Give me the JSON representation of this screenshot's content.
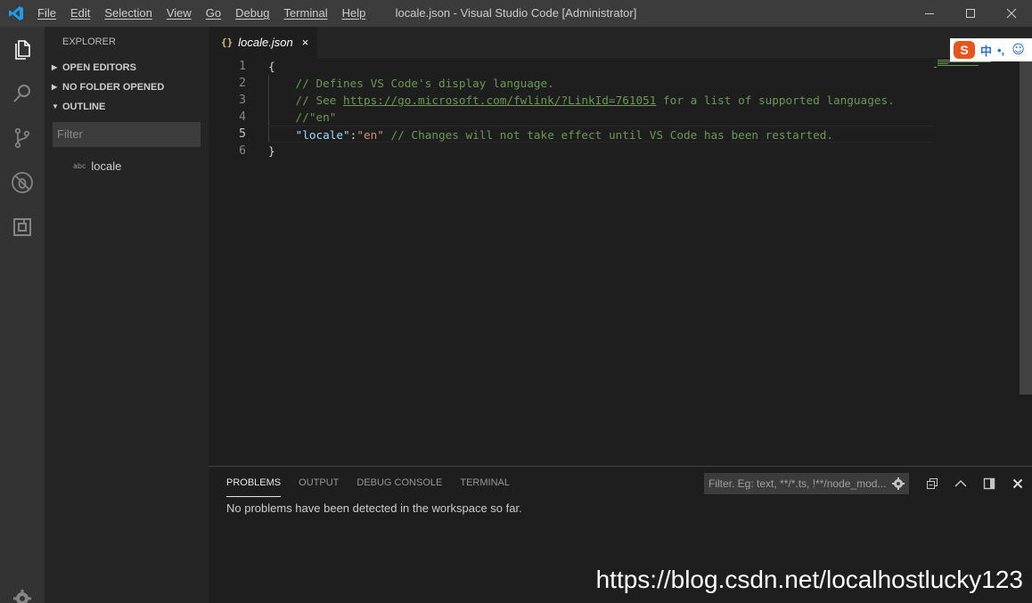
{
  "titlebar": {
    "menu": [
      "File",
      "Edit",
      "Selection",
      "View",
      "Go",
      "Debug",
      "Terminal",
      "Help"
    ],
    "title": "locale.json - Visual Studio Code [Administrator]",
    "icons": [
      "vscode-logo-icon",
      "minimize-icon",
      "maximize-icon",
      "close-icon"
    ]
  },
  "activitybar": {
    "icons": [
      "files-icon",
      "search-icon",
      "source-control-icon",
      "debug-icon",
      "extensions-icon",
      "gear-icon"
    ]
  },
  "sidebar": {
    "title": "EXPLORER",
    "sections": [
      "OPEN EDITORS",
      "NO FOLDER OPENED",
      "OUTLINE"
    ],
    "filter_placeholder": "Filter",
    "outline_item": "locale",
    "outline_item_badge": "abc"
  },
  "tab": {
    "icon": "{}",
    "label": "locale.json",
    "close": "×"
  },
  "editor": {
    "line_numbers": [
      "1",
      "2",
      "3",
      "4",
      "5",
      "6"
    ],
    "active_line": 5,
    "lines": {
      "l1": "{",
      "l2": "    // Defines VS Code's display language.",
      "l3_pre": "    // See ",
      "l3_link": "https://go.microsoft.com/fwlink/?LinkId=761051",
      "l3_post": " for a list of supported languages.",
      "l4": "    //\"en\"",
      "l5_indent": "    ",
      "l5_key": "\"locale\"",
      "l5_colon": ":",
      "l5_value": "\"en\"",
      "l5_comment": " // Changes will not take effect until VS Code has been restarted.",
      "l6": "}"
    }
  },
  "ime": {
    "logo": "S",
    "lang": "中",
    "punct": "•,",
    "emoji": "☺"
  },
  "panel": {
    "tabs": [
      "PROBLEMS",
      "OUTPUT",
      "DEBUG CONSOLE",
      "TERMINAL"
    ],
    "active_tab": "PROBLEMS",
    "filter_placeholder": "Filter. Eg: text, **/*.ts, !**/node_mod...",
    "message": "No problems have been detected in the workspace so far.",
    "actions": [
      "collapse-all-icon",
      "chevron-up-icon",
      "panel-layout-icon",
      "close-panel-icon"
    ]
  },
  "watermark": "https://blog.csdn.net/localhostlucky123",
  "colors": {
    "accent": "#007acc",
    "comment": "#6a9955",
    "key": "#9cdcfe",
    "string": "#ce9178"
  }
}
